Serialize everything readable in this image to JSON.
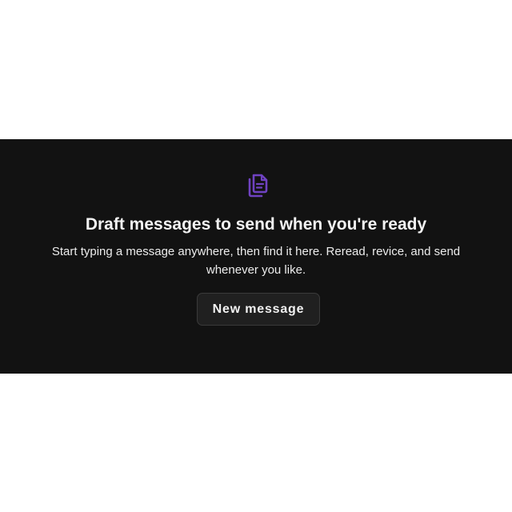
{
  "empty_state": {
    "icon": "drafts-document-icon",
    "icon_color": "#6f42c1",
    "title": "Draft messages to send when you're ready",
    "description": "Start typing a message anywhere, then find it here. Reread, revice, and send whenever you like.",
    "new_message_label": "New message"
  },
  "colors": {
    "panel_background": "#121212",
    "page_background": "#ffffff",
    "button_background": "#202020",
    "text": "#f3f3f3"
  }
}
